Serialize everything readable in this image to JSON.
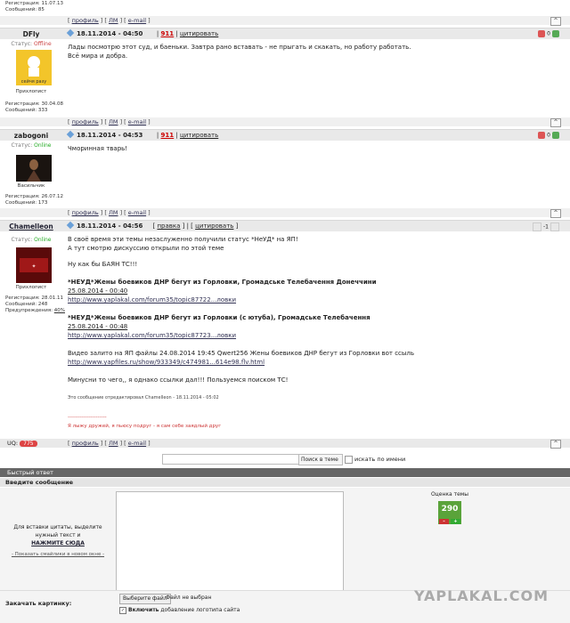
{
  "top_stub": {
    "reg": "Регистрация: 11.07.13",
    "msgs": "Сообщений: 85"
  },
  "links": {
    "profile": "профиль",
    "pm": "ЛМ",
    "email": "e-mail",
    "up": "^"
  },
  "posts": [
    {
      "name": "DFly",
      "date": "18.11.2014 - 04:50",
      "num": "911",
      "quote": "цитировать",
      "status_label": "Статус:",
      "status": "Offline",
      "avatar_caption": "сейчя разу",
      "rank": "Прихлопист",
      "reg": "Регистрация: 30.04.08",
      "msgs": "Сообщений: 333",
      "score": "0",
      "text": [
        "Лады посмотрю этот суд, и баеньки. Завтра рано вставать - не прыгать и скакать, но работу работать.",
        "Всё мира и добра."
      ]
    },
    {
      "name": "zabogoni",
      "date": "18.11.2014 - 04:53",
      "num": "911",
      "quote": "цитировать",
      "status_label": "Статус:",
      "status": "Online",
      "rank": "Васильчик",
      "reg": "Регистрация: 26.07.12",
      "msgs": "Сообщений: 173",
      "score": "0",
      "text": [
        "Чморинная тварь!"
      ]
    },
    {
      "name": "Chamelleon",
      "date": "18.11.2014 - 04:56",
      "edit": "правка",
      "quote": "цитировать",
      "status_label": "Статус:",
      "status": "Online",
      "rank": "Прихлопист",
      "reg": "Регистрация: 28.01.11",
      "msgs": "Сообщений: 248",
      "warn": "Предупреждения:",
      "warn_val": "40%",
      "score": "-1",
      "uq": "UQ:",
      "uq_val": "775",
      "lines": [
        "В своё время эти темы незаслуженно получили статус *НеУД* на ЯП!",
        "А тут смотрю дискуссию открыли по этой теме",
        "Ну как бы БАЯН ТС!!!",
        "*НЕУД*Жены боевиков ДНР бегут из Горловки, Громадське Телебачення Донеччини",
        "25.08.2014 - 00:40",
        "http://www.yaplakal.com/forum35/topic87722...ловки",
        "*НЕУД*Жены боевиков ДНР бегут из Горловки (с ютуба), Громадське Телебачення",
        "25.08.2014 - 00:48",
        "http://www.yaplakal.com/forum35/topic87723...ловки",
        "Видео залито на ЯП файлы 24.08.2014 19:45 Qwert256 Жены боевиков ДНР бегут из Горловки вот ссыль",
        "http://www.yapfiles.ru/show/933349/c474981...614e98.flv.html",
        "Минусни то чего,, я однако ссылки дал!!! Пользуемся поиском ТС!",
        "Это сообщение отредактировал Chamelleon - 18.11.2014 - 05:02",
        "----------------------",
        "Я лыжу дружей, я пьюсу подруг - я сам себе заядлый друг"
      ]
    }
  ],
  "search": {
    "select": "Поиск в теме »",
    "by_name": "искать по имени"
  },
  "quick_reply": {
    "title": "Быстрый ответ",
    "enter": "Введите сообщение",
    "hint": "Для вставки цитаты, выделите нужный текст и",
    "click": "НАЖМИТЕ СЮДА",
    "smiles": "- Показать смайлики в новом окне -",
    "rating_label": "Оценка темы",
    "rating": "290",
    "minus": "–",
    "plus": "+",
    "upload": "Закачать картинку:",
    "choose": "Выберите файл",
    "nofile": "Файл не выбран",
    "enable": "Включить",
    "logo_add": "добавление логотипа сайта"
  },
  "logo": "YAPLAKAL.COM",
  "colors": {
    "accent_red": "#cc0000",
    "online": "#22aa22",
    "rating_green": "#5aa33a"
  }
}
